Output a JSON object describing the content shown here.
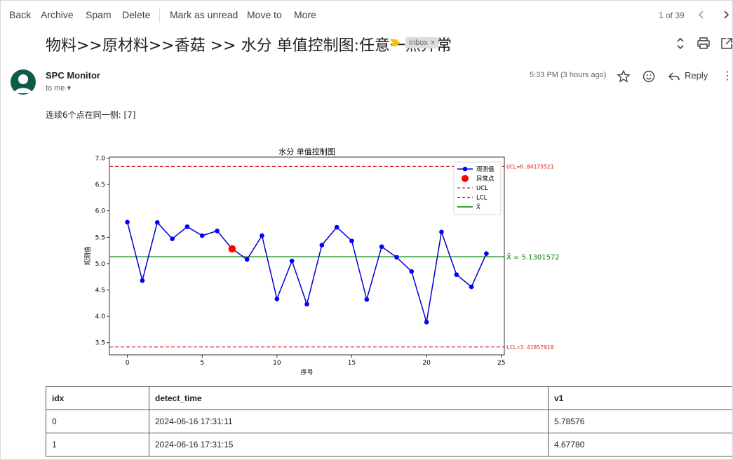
{
  "toolbar": {
    "back": "Back",
    "archive": "Archive",
    "spam": "Spam",
    "delete": "Delete",
    "mark_unread": "Mark as unread",
    "move_to": "Move to",
    "more": "More",
    "pager": "1 of 39"
  },
  "email": {
    "subject": "物料>>原材料>>香菇 >> 水分 单值控制图:任意一点异常",
    "label": "Inbox",
    "sender": "SPC Monitor",
    "to": "to me",
    "time": "5:33 PM (3 hours ago)",
    "reply": "Reply",
    "body": "连续6个点在同一侧: [7]"
  },
  "chart_data": {
    "type": "line",
    "title": "水分 单值控制图",
    "xlabel": "序号",
    "ylabel": "观测值",
    "xlim": [
      -1.2,
      25.2
    ],
    "ylim": [
      3.27,
      7.02
    ],
    "xticks": [
      0,
      5,
      10,
      15,
      20,
      25
    ],
    "yticks": [
      3.5,
      4.0,
      4.5,
      5.0,
      5.5,
      6.0,
      6.5,
      7.0
    ],
    "ytick_labels": [
      "3.5",
      "4.0",
      "4.5",
      "5.0",
      "5.5",
      "6.0",
      "6.5",
      "7.0"
    ],
    "x": [
      0,
      1,
      2,
      3,
      4,
      5,
      6,
      7,
      8,
      9,
      10,
      11,
      12,
      13,
      14,
      15,
      16,
      17,
      18,
      19,
      20,
      21,
      22,
      23,
      24
    ],
    "values": [
      5.78576,
      4.6778,
      5.78,
      5.47,
      5.7,
      5.53,
      5.62,
      5.28,
      5.08,
      5.53,
      4.33,
      5.05,
      4.23,
      5.35,
      5.69,
      5.43,
      4.32,
      5.32,
      5.12,
      4.85,
      3.89,
      5.6,
      4.79,
      4.56,
      5.19
    ],
    "anomalies": [
      7
    ],
    "ucl": 6.84173521,
    "lcl": 3.41857918,
    "mean": 5.1301572,
    "ucl_text": "UCL=6.84173521",
    "lcl_text": "LCL=3.41857918",
    "mean_text": "X̄ = 5.1301572",
    "legend": [
      "观测值",
      "异常点",
      "UCL",
      "LCL",
      "X̄"
    ],
    "legend_position": "top-right",
    "colors": {
      "line": "#0000cc",
      "point": "#0000ff",
      "anomaly": "#ff0000",
      "limit": "#d62728",
      "mean": "#008000"
    }
  },
  "table": {
    "headers": [
      "idx",
      "detect_time",
      "v1"
    ],
    "rows": [
      [
        "0",
        "2024-06-16 17:31:11",
        "5.78576"
      ],
      [
        "1",
        "2024-06-16 17:31:15",
        "4.67780"
      ]
    ]
  }
}
